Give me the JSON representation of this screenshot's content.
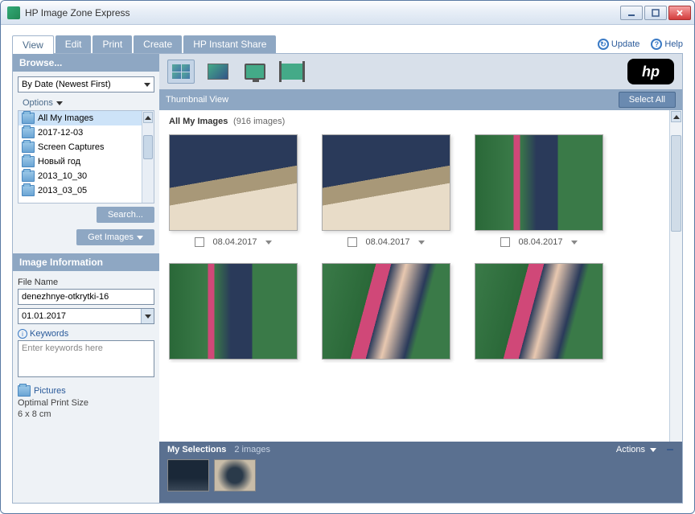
{
  "window": {
    "title": "HP Image Zone Express"
  },
  "tabs": {
    "view": "View",
    "edit": "Edit",
    "print": "Print",
    "create": "Create",
    "share": "HP Instant Share"
  },
  "help": {
    "update": "Update",
    "help": "Help"
  },
  "browse": {
    "header": "Browse...",
    "sort": "By Date (Newest First)",
    "options": "Options",
    "folders": [
      "All My Images",
      "2017-12-03",
      "Screen Captures",
      "Новый год",
      "2013_10_30",
      "2013_03_05"
    ],
    "search_btn": "Search...",
    "get_images_btn": "Get Images"
  },
  "info": {
    "header": "Image Information",
    "filename_label": "File Name",
    "filename_value": "denezhnye-otkrytki-16",
    "date_value": "01.01.2017",
    "keywords_label": "Keywords",
    "keywords_placeholder": "Enter keywords here",
    "location": "Pictures",
    "print_size_label": "Optimal Print Size",
    "print_size_value": "6 x 8 cm"
  },
  "thumbnail": {
    "header": "Thumbnail View",
    "select_all": "Select All",
    "title": "All My Images",
    "count": "(916 images)",
    "dates": [
      "08.04.2017",
      "08.04.2017",
      "08.04.2017"
    ]
  },
  "selections": {
    "header": "My Selections",
    "count": "2 images",
    "actions": "Actions"
  },
  "hp_logo": "hp"
}
